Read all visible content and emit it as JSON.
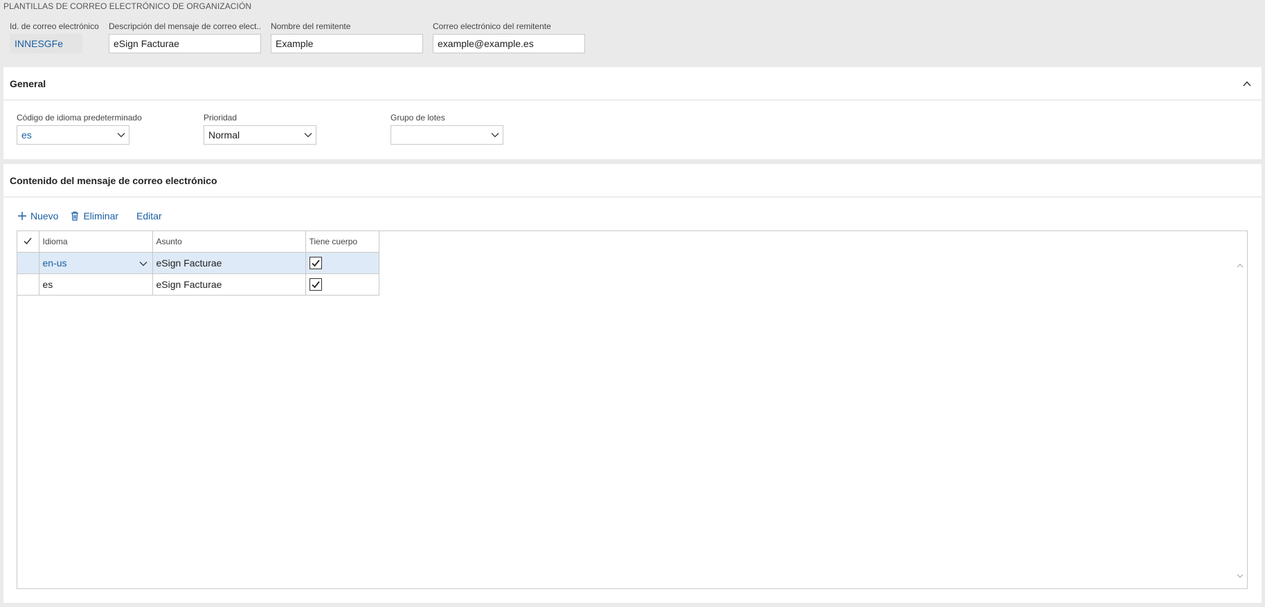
{
  "page": {
    "title": "PLANTILLAS DE CORREO ELECTRÓNICO DE ORGANIZACIÓN"
  },
  "header": {
    "email_id": {
      "label": "Id. de correo electrónico",
      "value": "INNESGFe"
    },
    "description": {
      "label": "Descripción del mensaje de correo elect...",
      "value": "eSign Facturae"
    },
    "sender_name": {
      "label": "Nombre del remitente",
      "value": "Example"
    },
    "sender_email": {
      "label": "Correo electrónico del remitente",
      "value": "example@example.es"
    }
  },
  "general": {
    "title": "General",
    "default_language": {
      "label": "Código de idioma predeterminado",
      "value": "es"
    },
    "priority": {
      "label": "Prioridad",
      "value": "Normal"
    },
    "batch_group": {
      "label": "Grupo de lotes",
      "value": ""
    }
  },
  "content": {
    "title": "Contenido del mensaje de correo electrónico",
    "toolbar": {
      "new_label": "Nuevo",
      "delete_label": "Eliminar",
      "edit_label": "Editar"
    },
    "columns": {
      "language": "Idioma",
      "subject": "Asunto",
      "has_body": "Tiene cuerpo"
    },
    "rows": [
      {
        "language": "en-us",
        "subject": "eSign Facturae",
        "has_body": true,
        "selected": true
      },
      {
        "language": "es",
        "subject": "eSign Facturae",
        "has_body": true,
        "selected": false
      }
    ]
  },
  "colors": {
    "accent": "#1a5fa3",
    "selected_row": "#deeaf7",
    "background": "#eaeaea"
  },
  "icons": {
    "collapse": "chevron-up-icon",
    "new": "plus-icon",
    "delete": "trash-icon",
    "dropdown": "chevron-down-icon",
    "check": "check-icon"
  }
}
